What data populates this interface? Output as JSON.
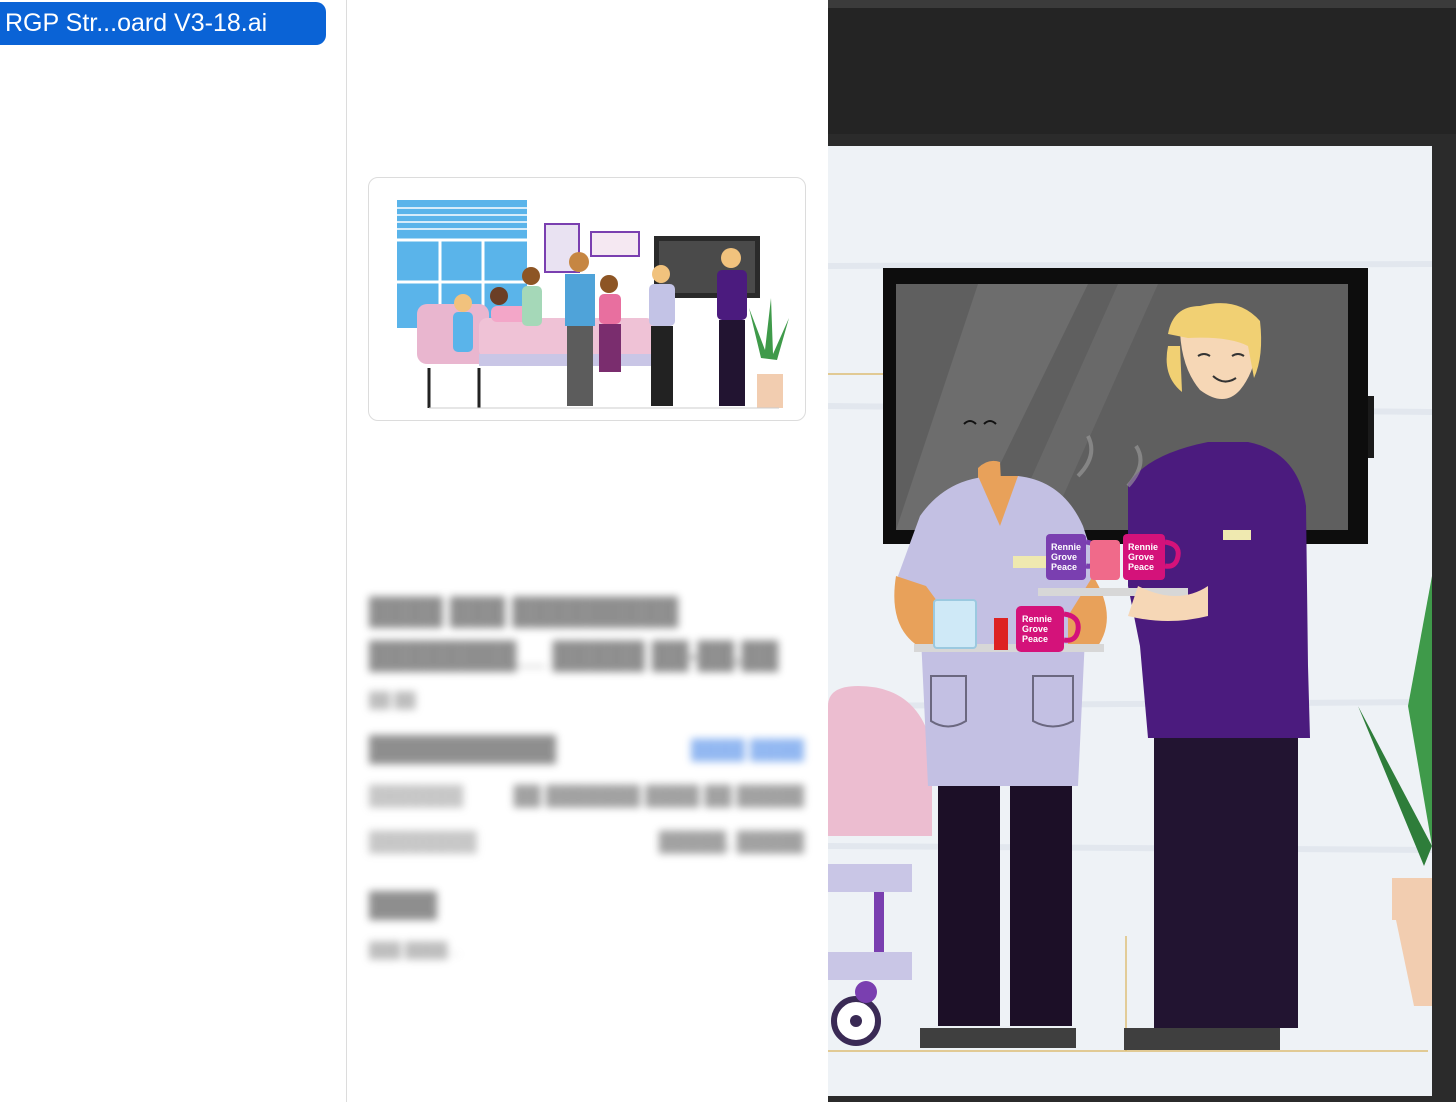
{
  "sidebar": {
    "selected_file": "RGP Str...oard V3-18.ai"
  },
  "artwork": {
    "mug_brand_line1": "Rennie",
    "mug_brand_line2": "Grove",
    "mug_brand_line3": "Peace"
  },
  "colors": {
    "selection_blue": "#0a63d6",
    "nurse_purple": "#4b1b7e",
    "mug_pink": "#d4127a",
    "app_dark": "#242424"
  }
}
